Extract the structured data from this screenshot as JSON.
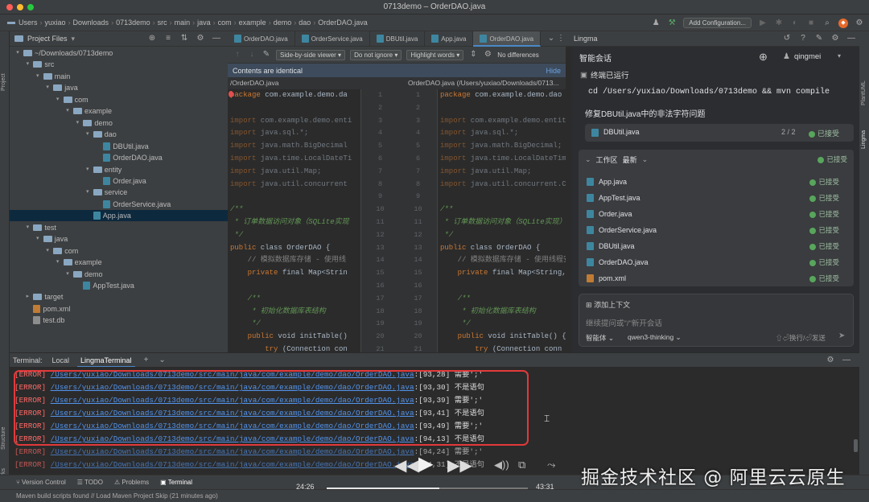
{
  "window": {
    "title": "0713demo – OrderDAO.java"
  },
  "breadcrumbs": [
    "Users",
    "yuxiao",
    "Downloads",
    "0713demo",
    "src",
    "main",
    "java",
    "com",
    "example",
    "demo",
    "dao",
    "OrderDAO.java"
  ],
  "toolbar": {
    "run_config_label": "Add Configuration..."
  },
  "left_strip": {
    "project_label": "Project",
    "structure_label": "Structure",
    "bookmarks_label": "Bookmarks"
  },
  "project": {
    "header": "Project Files",
    "tree": [
      {
        "label": "~/Downloads/0713demo",
        "icon": "folder",
        "expanded": true
      },
      {
        "label": "src",
        "icon": "folder",
        "expanded": true
      },
      {
        "label": "main",
        "icon": "folder",
        "expanded": true
      },
      {
        "label": "java",
        "icon": "folder",
        "expanded": true
      },
      {
        "label": "com",
        "icon": "folder",
        "expanded": true
      },
      {
        "label": "example",
        "icon": "folder",
        "expanded": true
      },
      {
        "label": "demo",
        "icon": "folder",
        "expanded": true
      },
      {
        "label": "dao",
        "icon": "folder",
        "expanded": true
      },
      {
        "label": "DBUtil.java",
        "icon": "java-file"
      },
      {
        "label": "OrderDAO.java",
        "icon": "java-file"
      },
      {
        "label": "entity",
        "icon": "folder",
        "expanded": true
      },
      {
        "label": "Order.java",
        "icon": "java-file"
      },
      {
        "label": "service",
        "icon": "folder",
        "expanded": true
      },
      {
        "label": "OrderService.java",
        "icon": "java-file"
      },
      {
        "label": "App.java",
        "icon": "java-file",
        "selected": true
      },
      {
        "label": "test",
        "icon": "folder",
        "expanded": true
      },
      {
        "label": "java",
        "icon": "folder",
        "expanded": true
      },
      {
        "label": "com",
        "icon": "folder",
        "expanded": true
      },
      {
        "label": "example",
        "icon": "folder",
        "expanded": true
      },
      {
        "label": "demo",
        "icon": "folder",
        "expanded": true
      },
      {
        "label": "AppTest.java",
        "icon": "java-file"
      },
      {
        "label": "target",
        "icon": "folder",
        "expanded": false
      },
      {
        "label": "pom.xml",
        "icon": "xml-file"
      },
      {
        "label": "test.db",
        "icon": "db-file"
      }
    ]
  },
  "editor": {
    "tabs": [
      {
        "label": "OrderDAO.java",
        "active": false
      },
      {
        "label": "OrderService.java",
        "active": false
      },
      {
        "label": "DBUtil.java",
        "active": false
      },
      {
        "label": "App.java",
        "active": false
      },
      {
        "label": "OrderDAO.java",
        "active": true
      }
    ],
    "diff": {
      "viewer_mode": "Side-by-side viewer",
      "ignore_mode": "Do not ignore",
      "highlight_mode": "Highlight words",
      "no_differences": "No differences",
      "banner_text": "Contents are identical",
      "banner_hide": "Hide",
      "left_path": "/OrderDAO.java",
      "right_path": "OrderDAO.java (/Users/yuxiao/Downloads/0713...",
      "line_numbers": [
        "1",
        "2",
        "3",
        "4",
        "5",
        "6",
        "7",
        "8",
        "9",
        "10",
        "11",
        "12",
        "13",
        "14",
        "15",
        "16",
        "17",
        "18",
        "19",
        "20",
        "21"
      ],
      "left_lines": [
        "package com.example.demo.da",
        "",
        "import com.example.demo.enti",
        "import java.sql.*;",
        "import java.math.BigDecimal",
        "import java.time.LocalDateTi",
        "import java.util.Map;",
        "import java.util.concurrent",
        "",
        "/**",
        " * 订单数据访问对象（SQLite实现",
        " */",
        "public class OrderDAO {",
        "    // 模拟数据库存储 - 使用线",
        "    private final Map<Strin",
        "",
        "    /**",
        "     * 初始化数据库表结构",
        "     */",
        "    public void initTable()",
        "        try (Connection con"
      ],
      "right_lines": [
        "package com.example.demo.dao",
        "",
        "import com.example.demo.entit",
        "import java.sql.*;",
        "import java.math.BigDecimal;",
        "import java.time.LocalDateTim",
        "import java.util.Map;",
        "import java.util.concurrent.C",
        "",
        "/**",
        " * 订单数据访问对象（SQLite实现）",
        " */",
        "public class OrderDAO {",
        "    // 模拟数据库存储 - 使用线程安",
        "    private final Map<String,",
        "",
        "    /**",
        "     * 初始化数据库表结构",
        "     */",
        "    public void initTable() {",
        "        try (Connection conn"
      ]
    }
  },
  "lingma": {
    "panel_title": "Lingma",
    "chat_title": "智能会话",
    "user": "qingmei",
    "terminal_done": "终端已运行",
    "command": "cd /Users/yuxiao/Downloads/0713demo && mvn compile",
    "fix_title": "修复DBUtil.java中的非法字符问题",
    "fix_file": {
      "name": "DBUtil.java",
      "count": "2 / 2",
      "status": "已接受"
    },
    "workspace": {
      "title": "工作区",
      "filter": "最新",
      "status": "已接受",
      "files": [
        {
          "name": "App.java",
          "status": "已接受",
          "icon": "java-file"
        },
        {
          "name": "AppTest.java",
          "status": "已接受",
          "icon": "java-file"
        },
        {
          "name": "Order.java",
          "status": "已接受",
          "icon": "java-file"
        },
        {
          "name": "OrderService.java",
          "status": "已接受",
          "icon": "java-file"
        },
        {
          "name": "DBUtil.java",
          "status": "已接受",
          "icon": "java-file"
        },
        {
          "name": "OrderDAO.java",
          "status": "已接受",
          "icon": "java-file"
        },
        {
          "name": "pom.xml",
          "status": "已接受",
          "icon": "xml-file"
        }
      ]
    },
    "input": {
      "add_context": "添加上下文",
      "placeholder": "继续提问或\"/\"新开会话",
      "mode": "智能体",
      "model": "qwen3-thinking",
      "send_hint": "⇧⏎换行/⏎发送"
    }
  },
  "terminal": {
    "label": "Terminal:",
    "tabs": [
      {
        "label": "Local",
        "active": false
      },
      {
        "label": "LingmaTerminal",
        "active": true
      }
    ],
    "lines": [
      {
        "tag": "[ERROR]",
        "path": "/Users/yuxiao/Downloads/0713demo/src/main/java/com/example/demo/dao/OrderDAO.java",
        "pos": ":[93,28]",
        "msg": " 需要';'"
      },
      {
        "tag": "[ERROR]",
        "path": "/Users/yuxiao/Downloads/0713demo/src/main/java/com/example/demo/dao/OrderDAO.java",
        "pos": ":[93,30]",
        "msg": " 不是语句"
      },
      {
        "tag": "[ERROR]",
        "path": "/Users/yuxiao/Downloads/0713demo/src/main/java/com/example/demo/dao/OrderDAO.java",
        "pos": ":[93,39]",
        "msg": " 需要';'"
      },
      {
        "tag": "[ERROR]",
        "path": "/Users/yuxiao/Downloads/0713demo/src/main/java/com/example/demo/dao/OrderDAO.java",
        "pos": ":[93,41]",
        "msg": " 不是语句"
      },
      {
        "tag": "[ERROR]",
        "path": "/Users/yuxiao/Downloads/0713demo/src/main/java/com/example/demo/dao/OrderDAO.java",
        "pos": ":[93,49]",
        "msg": " 需要';'"
      },
      {
        "tag": "[ERROR]",
        "path": "/Users/yuxiao/Downloads/0713demo/src/main/java/com/example/demo/dao/OrderDAO.java",
        "pos": ":[94,13]",
        "msg": " 不是语句"
      },
      {
        "tag": "[ERROR]",
        "path": "/Users/yuxiao/Downloads/0713demo/src/main/java/com/example/demo/dao/OrderDAO.java",
        "pos": ":[94,24]",
        "msg": " 需要';'"
      },
      {
        "tag": "[ERROR]",
        "path": "/Users/yuxiao/Downloads/0713demo/src/main/java/com/example/demo/dao/OrderDAO.java",
        "pos": ":[94,31]",
        "msg": " 不是语句"
      }
    ]
  },
  "tool_windows": [
    "Version Control",
    "TODO",
    "Problems",
    "Terminal"
  ],
  "status_bar": {
    "text": "Maven build scripts found // Load Maven Project  Skip (21 minutes ago)"
  },
  "video": {
    "current_time": "24:26",
    "total_time": "43:31",
    "progress": 0.56
  },
  "watermark": "掘金技术社区 @ 阿里云云原生",
  "colors": {
    "accent": "#4a88c7",
    "error": "#ff6b68",
    "link": "#5394ec",
    "highlight_box": "#e3393b",
    "accepted": "#58a55c"
  }
}
